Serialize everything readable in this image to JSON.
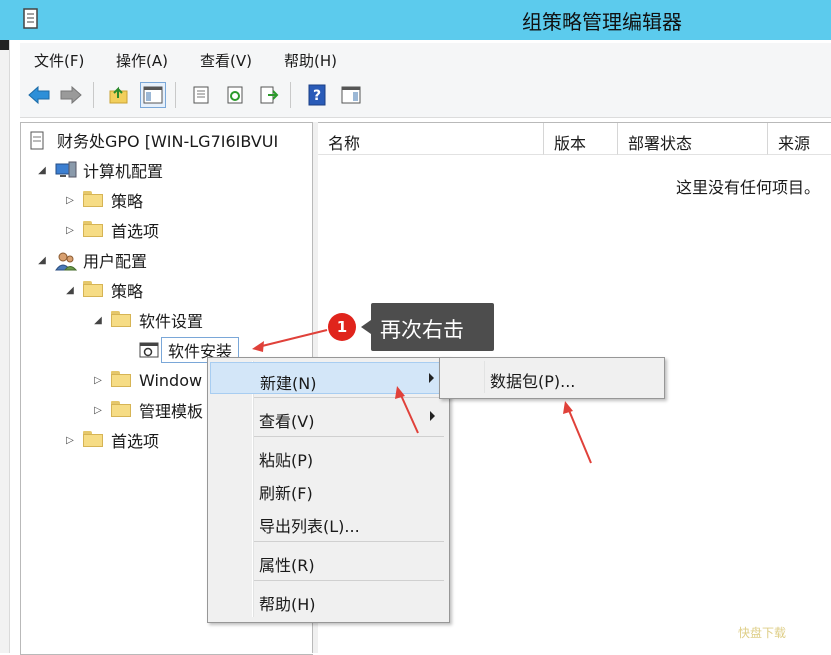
{
  "window": {
    "title": "组策略管理编辑器"
  },
  "menu": [
    "文件(F)",
    "操作(A)",
    "查看(V)",
    "帮助(H)"
  ],
  "toolbar": [
    "back-icon",
    "forward-icon",
    "up-folder-icon",
    "show-hide-tree-icon",
    "properties-icon",
    "refresh-icon",
    "export-list-icon",
    "help-icon",
    "show-hide-action-pane-icon"
  ],
  "tree": {
    "root": "财务处GPO [WIN-LG7I6IBVUI",
    "computer_config": "计算机配置",
    "c_policies": "策略",
    "c_preferences": "首选项",
    "user_config": "用户配置",
    "u_policies": "策略",
    "software_settings": "软件设置",
    "software_install": "软件安装",
    "windows_settings": "Window",
    "admin_templates": "管理模板",
    "u_preferences": "首选项"
  },
  "columns": [
    "名称",
    "版本",
    "部署状态",
    "来源"
  ],
  "empty_message": "这里没有任何项目。",
  "context_menu": {
    "new": "新建(N)",
    "view": "查看(V)",
    "paste": "粘贴(P)",
    "refresh": "刷新(F)",
    "export": "导出列表(L)...",
    "properties": "属性(R)",
    "help": "帮助(H)"
  },
  "submenu": {
    "package": "数据包(P)..."
  },
  "annotation": {
    "step": "1",
    "text": "再次右击"
  },
  "watermark": "快盘下载",
  "colors": {
    "titlebar": "#5ccbed",
    "callout": "#4d4d4d",
    "badge": "#e0241c",
    "arrow": "#e0413a",
    "highlight": "#d3e6f8"
  }
}
